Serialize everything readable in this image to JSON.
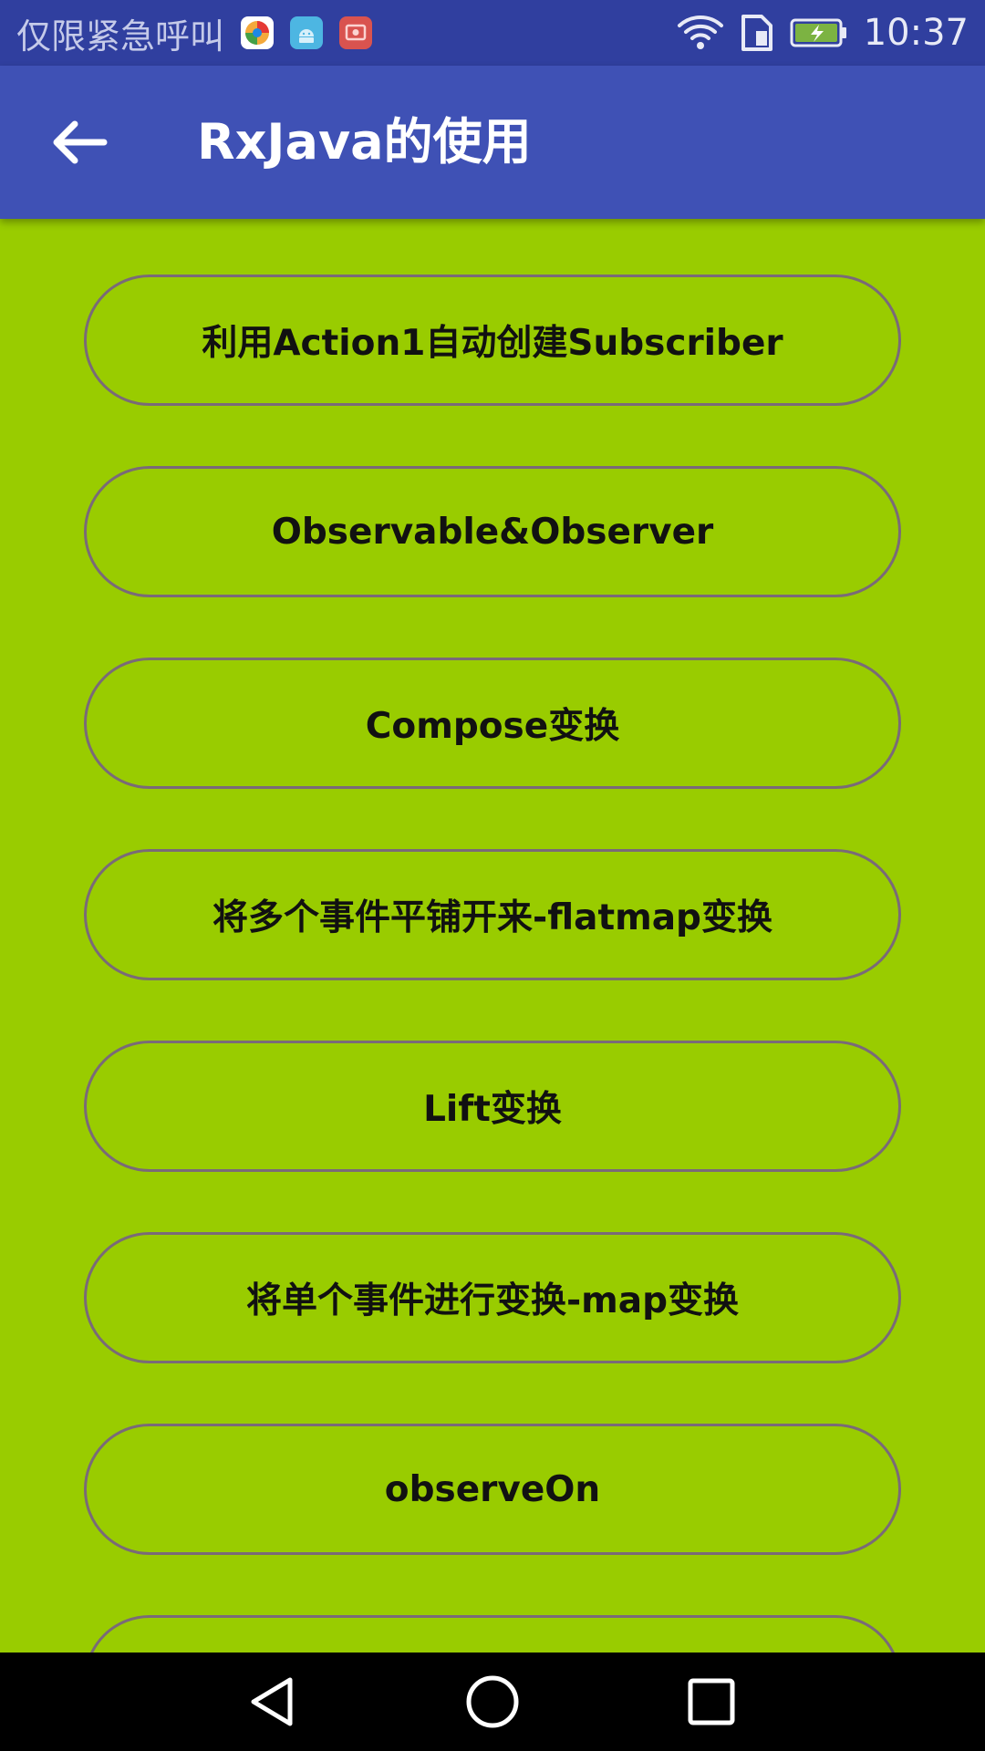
{
  "status_bar": {
    "carrier": "仅限紧急呼叫",
    "time": "10:37",
    "notification_icons": [
      "browser-app-icon",
      "android-app-icon",
      "screen-recorder-icon"
    ],
    "system_icons": [
      "wifi-icon",
      "sim-card-icon",
      "battery-charging-icon"
    ]
  },
  "app_bar": {
    "title": "RxJava的使用",
    "back_icon": "arrow-back-icon",
    "color": "#3f51b5"
  },
  "buttons": [
    "利用Action1自动创建Subscriber",
    "Observable&Observer",
    "Compose变换",
    "将多个事件平铺开来-flatmap变换",
    "Lift变换",
    "将单个事件进行变换-map变换",
    "observeOn",
    ""
  ],
  "nav_bar": {
    "icons": [
      "back-triangle-icon",
      "home-circle-icon",
      "recents-square-icon"
    ]
  },
  "colors": {
    "status_bar": "#303f9f",
    "background": "#99cc00",
    "button_border": "#7a6a78"
  }
}
